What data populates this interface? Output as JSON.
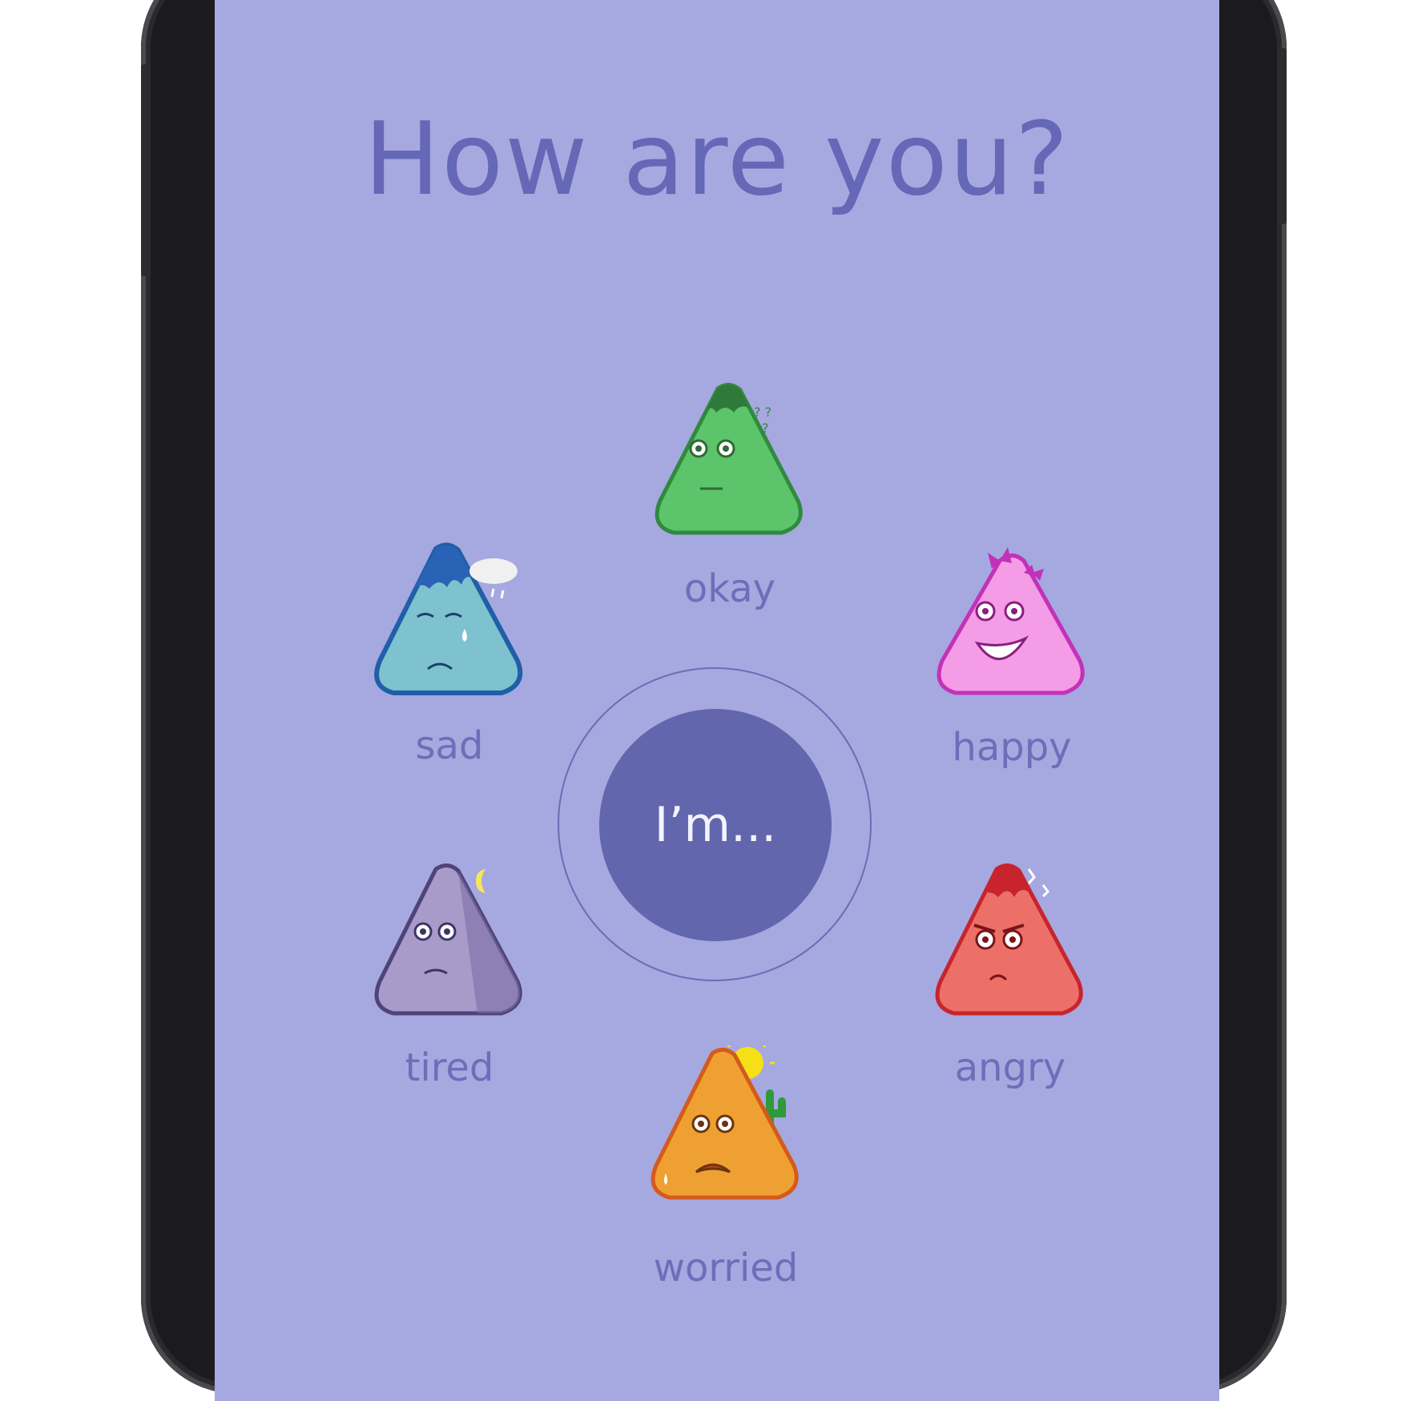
{
  "title": "How are you?",
  "center_button": {
    "label": "I’m..."
  },
  "moods": {
    "okay": {
      "label": "okay",
      "color": "#5cc46a"
    },
    "sad": {
      "label": "sad",
      "color": "#7ec1cf"
    },
    "happy": {
      "label": "happy",
      "color": "#f49ce6"
    },
    "tired": {
      "label": "tired",
      "color": "#a89bc9"
    },
    "angry": {
      "label": "angry",
      "color": "#ec7068"
    },
    "worried": {
      "label": "worried",
      "color": "#efa033"
    }
  },
  "colors": {
    "screen_background": "#a6a8e0",
    "accent": "#6266ad",
    "text": "#6b6fb9"
  }
}
